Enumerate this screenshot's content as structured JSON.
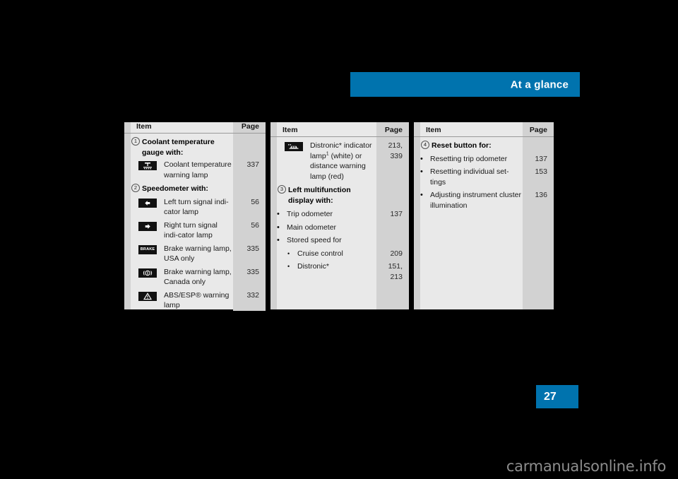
{
  "header": {
    "title": "At a glance",
    "bar_color": "#0073ae"
  },
  "page": {
    "number": "27",
    "badge_color": "#0073ae"
  },
  "watermark": {
    "text": "carmanualsonline.info",
    "color": "#8d8d8d"
  },
  "columns": {
    "item": "Item",
    "page": "Page"
  },
  "tables": [
    {
      "rows": [
        {
          "marker": "1",
          "kind": "heading",
          "text": "Coolant temperature gauge with:",
          "page": ""
        },
        {
          "icon": "coolant-temperature-warning-icon",
          "kind": "symbol",
          "text": "Coolant temperature warning lamp",
          "page": "337"
        },
        {
          "marker": "2",
          "kind": "heading",
          "text": "Speedometer with:",
          "page": ""
        },
        {
          "icon": "left-turn-signal-icon",
          "kind": "symbol",
          "text": "Left turn signal indi-cator lamp",
          "page": "56"
        },
        {
          "icon": "right-turn-signal-icon",
          "kind": "symbol",
          "text": "Right turn signal indi-cator lamp",
          "page": "56"
        },
        {
          "icon": "brake-warning-usa-icon",
          "kind": "symbol",
          "text": "Brake warning lamp, USA only",
          "page": "335"
        },
        {
          "icon": "brake-warning-canada-icon",
          "kind": "symbol",
          "text": "Brake warning lamp, Canada only",
          "page": "335"
        },
        {
          "icon": "abs-esp-warning-icon",
          "kind": "symbol",
          "text": "ABS/ESP® warning lamp",
          "page": "332"
        }
      ]
    },
    {
      "rows": [
        {
          "icon": "distronic-indicator-icon",
          "kind": "symbol",
          "text_html": "Distronic* indicator lamp<sup>1</sup> (white) or distance warning lamp (red)",
          "page": "213, 339"
        },
        {
          "marker": "3",
          "kind": "heading",
          "text": "Left multifunction display with:",
          "page": ""
        },
        {
          "kind": "bullet",
          "text": "Trip odometer",
          "page": "137"
        },
        {
          "kind": "bullet",
          "text": "Main odometer",
          "page": ""
        },
        {
          "kind": "bullet",
          "text": "Stored speed for",
          "page": ""
        },
        {
          "kind": "subbullet",
          "text": "Cruise control",
          "page": "209"
        },
        {
          "kind": "subbullet",
          "text": "Distronic*",
          "page": "151, 213"
        }
      ]
    },
    {
      "rows": [
        {
          "marker": "4",
          "kind": "heading",
          "text": "Reset button for:",
          "page": ""
        },
        {
          "kind": "bullet",
          "text": "Resetting trip odometer",
          "page": "137"
        },
        {
          "kind": "bullet",
          "text": "Resetting individual set-tings",
          "page": "153"
        },
        {
          "kind": "bullet",
          "text": "Adjusting instrument cluster illumination",
          "page": "136"
        }
      ]
    }
  ]
}
